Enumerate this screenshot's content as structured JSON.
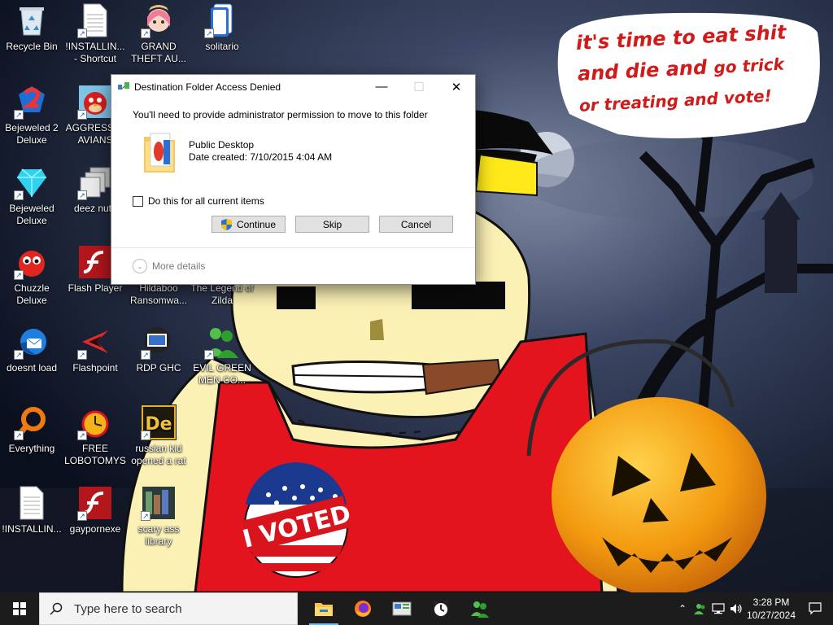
{
  "desktop": {
    "icons": [
      {
        "label": "Recycle Bin",
        "glyph": "recycle-bin-icon"
      },
      {
        "label": "!INSTALLIN... - Shortcut",
        "glyph": "document-icon"
      },
      {
        "label": "GRAND THEFT AU...",
        "glyph": "anime-girl-icon"
      },
      {
        "label": "solitario",
        "glyph": "solitaire-icon"
      },
      {
        "label": "Bejeweled 2 Deluxe",
        "glyph": "bejeweled2-icon"
      },
      {
        "label": "AGGRESSI... AVIANS",
        "glyph": "angry-bird-icon"
      },
      {
        "label": "Bejeweled Deluxe",
        "glyph": "diamond-icon"
      },
      {
        "label": "deez nuts",
        "glyph": "stacked-windows-icon"
      },
      {
        "label": "Chuzzle Deluxe",
        "glyph": "chuzzle-icon"
      },
      {
        "label": "Flash Player",
        "glyph": "flash-icon"
      },
      {
        "label": "Hildaboo Ransomwa...",
        "glyph": "blank-icon"
      },
      {
        "label": "The Legend of Zilda",
        "glyph": "blank-icon"
      },
      {
        "label": "doesnt load",
        "glyph": "thunderbird-icon"
      },
      {
        "label": "Flashpoint",
        "glyph": "flashpoint-icon"
      },
      {
        "label": "RDP GHC",
        "glyph": "rdp-icon"
      },
      {
        "label": "EVIL GREEN MEN CO...",
        "glyph": "green-men-icon"
      },
      {
        "label": "Everything",
        "glyph": "everything-icon"
      },
      {
        "label": "FREE LOBOTOMYS",
        "glyph": "fire-clock-icon"
      },
      {
        "label": "russian kid opened a rat",
        "glyph": "de-icon"
      },
      {
        "label": "!INSTALLIN...",
        "glyph": "document-icon"
      },
      {
        "label": "gaypornexe",
        "glyph": "flash-icon"
      },
      {
        "label": "scary ass library",
        "glyph": "library-icon"
      }
    ]
  },
  "wallpaper": {
    "bubble_line1": "it's time to eat shit",
    "bubble_line2a": "and die and",
    "bubble_line2b": "go trick",
    "bubble_line3": "or treating and vote!",
    "sticker_text": "I VOTED"
  },
  "dialog": {
    "title": "Destination Folder Access Denied",
    "message": "You'll need to provide administrator permission to move to this folder",
    "folder_name": "Public Desktop",
    "folder_date": "Date created: 7/10/2015 4:04 AM",
    "checkbox_label": "Do this for all current items",
    "checkbox_checked": false,
    "continue_label": "Continue",
    "skip_label": "Skip",
    "cancel_label": "Cancel",
    "more_details_label": "More details"
  },
  "taskbar": {
    "search_placeholder": "Type here to search",
    "apps": [
      "file-explorer-icon",
      "firefox-icon",
      "media-app-icon",
      "alarm-clock-icon",
      "green-men-icon"
    ],
    "clock_time": "3:28 PM",
    "clock_date": "10/27/2024"
  },
  "colors": {
    "taskbar_bg": "#1c1c1c",
    "bubble_text": "#d11a1a",
    "accent": "#0078d7"
  }
}
